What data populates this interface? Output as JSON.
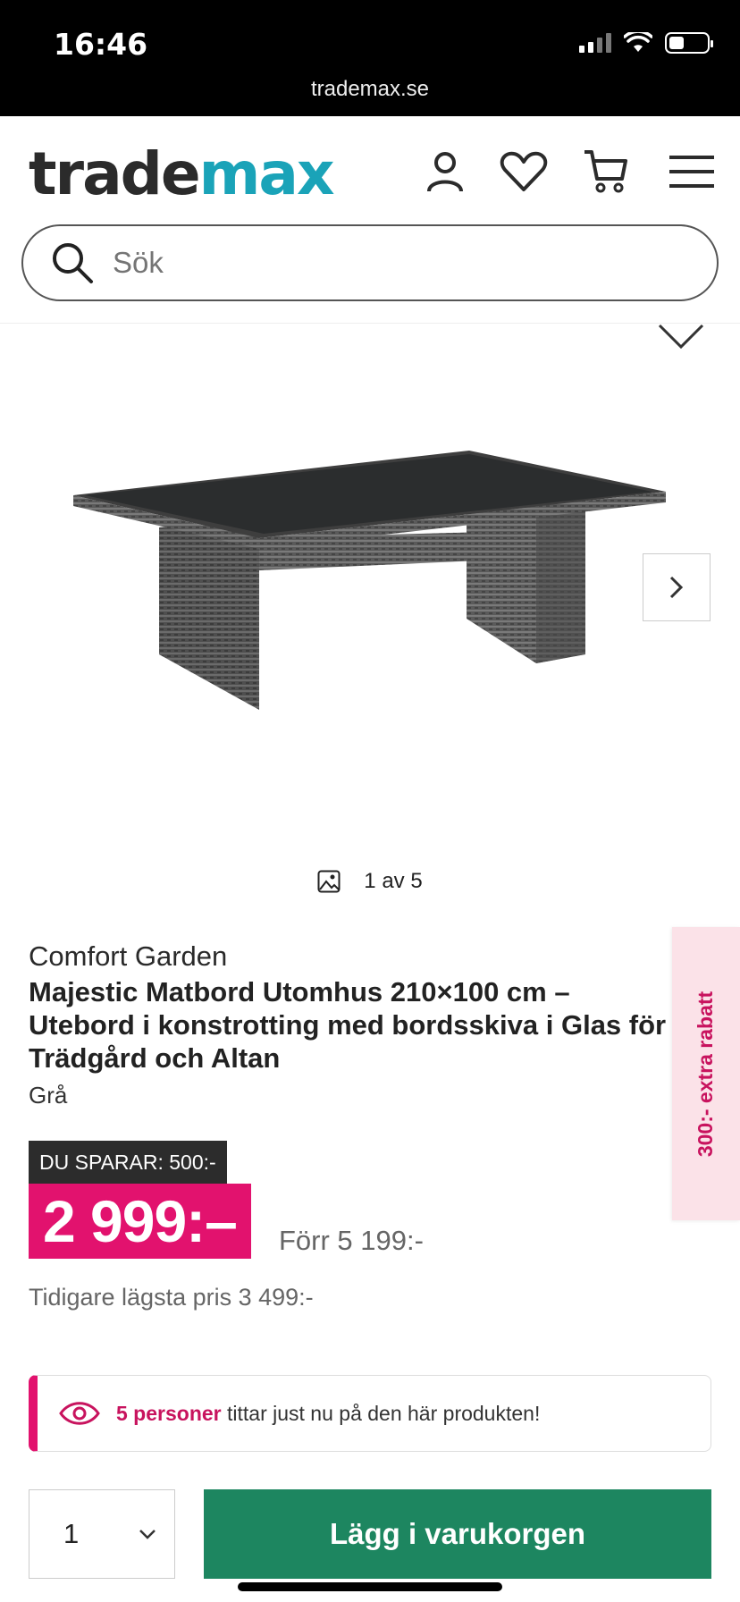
{
  "status": {
    "time": "16:46",
    "url": "trademax.se"
  },
  "header": {
    "logo_part1": "trade",
    "logo_part2": "max",
    "icons": [
      "user-icon",
      "heart-icon",
      "cart-icon",
      "menu-icon"
    ],
    "search_placeholder": "Sök"
  },
  "gallery": {
    "counter": "1 av 5"
  },
  "product": {
    "brand": "Comfort Garden",
    "title_line1": "Majestic Matbord Utomhus 210×100 cm –",
    "title_line2": "Utebord i konstrotting med bordsskiva i Glas för",
    "title_line3": "Trädgård och Altan",
    "variant": "Grå"
  },
  "pricing": {
    "savings": "DU SPARAR: 500:-",
    "price": "2 999:–",
    "old_price": "Förr 5 199:-",
    "lowest_price": "Tidigare lägsta pris 3 499:-"
  },
  "side_tab": {
    "label": "300:- extra rabatt"
  },
  "viewers": {
    "count": "5 personer",
    "text": "tittar just nu på den här produkten!"
  },
  "purchase": {
    "quantity": "1",
    "add_to_cart": "Lägg i varukorgen"
  },
  "colors": {
    "brand_teal": "#1aa3b8",
    "price_pink": "#e2126e",
    "cart_green": "#1d8660"
  }
}
